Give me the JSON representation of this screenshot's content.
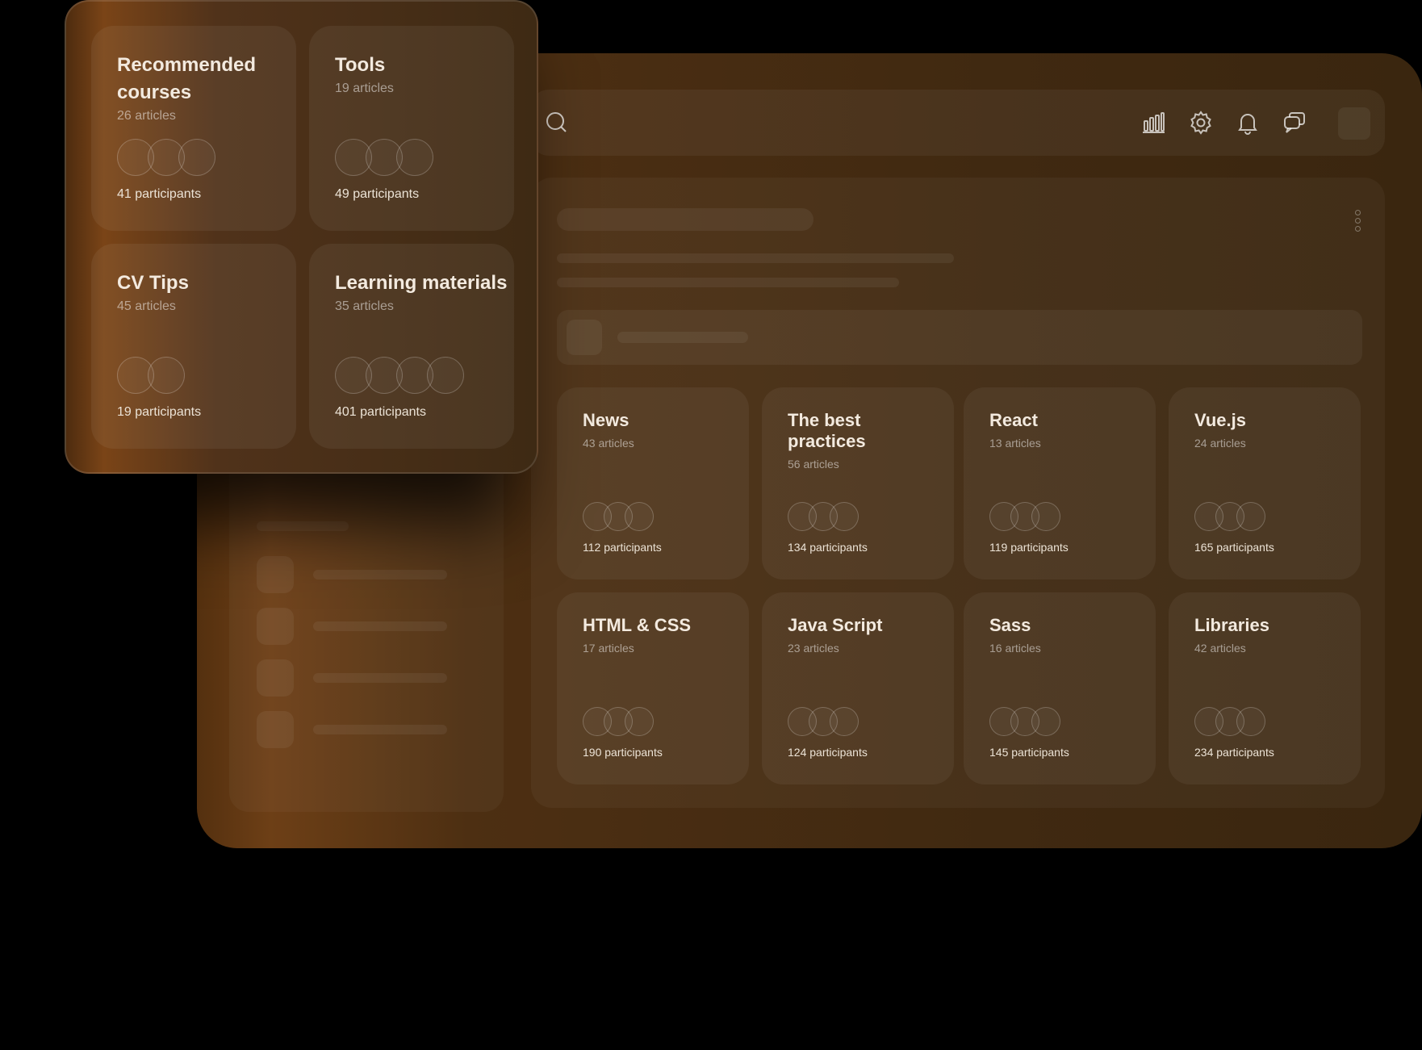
{
  "popup": {
    "cards": [
      {
        "title": "Recommended courses",
        "articles": "26 articles",
        "participants": "41 participants",
        "avatars": 3
      },
      {
        "title": "Tools",
        "articles": "19 articles",
        "participants": "49 participants",
        "avatars": 3
      },
      {
        "title": "CV Tips",
        "articles": "45 articles",
        "participants": "19 participants",
        "avatars": 2
      },
      {
        "title": "Learning materials",
        "articles": "35 articles",
        "participants": "401 participants",
        "avatars": 4
      }
    ]
  },
  "topbar": {
    "icons": [
      "search-icon",
      "bar-chart-icon",
      "gear-icon",
      "bell-icon",
      "chat-icon"
    ]
  },
  "main": {
    "cards": [
      {
        "title": "News",
        "articles": "43 articles",
        "participants": "112 participants"
      },
      {
        "title": "The best practices",
        "articles": "56 articles",
        "participants": "134 participants"
      },
      {
        "title": "React",
        "articles": "13 articles",
        "participants": "119 participants"
      },
      {
        "title": "Vue.js",
        "articles": "24 articles",
        "participants": "165 participants"
      },
      {
        "title": "HTML & CSS",
        "articles": "17 articles",
        "participants": "190 participants"
      },
      {
        "title": "Java Script",
        "articles": "23 articles",
        "participants": "124 participants"
      },
      {
        "title": "Sass",
        "articles": "16 articles",
        "participants": "145 participants"
      },
      {
        "title": "Libraries",
        "articles": "42 articles",
        "participants": "234 participants"
      }
    ]
  },
  "colors": {
    "background": "#000000",
    "window_accent": "#6d3f16",
    "text_primary": "#f3eadf",
    "text_muted": "#9a8c7c"
  }
}
